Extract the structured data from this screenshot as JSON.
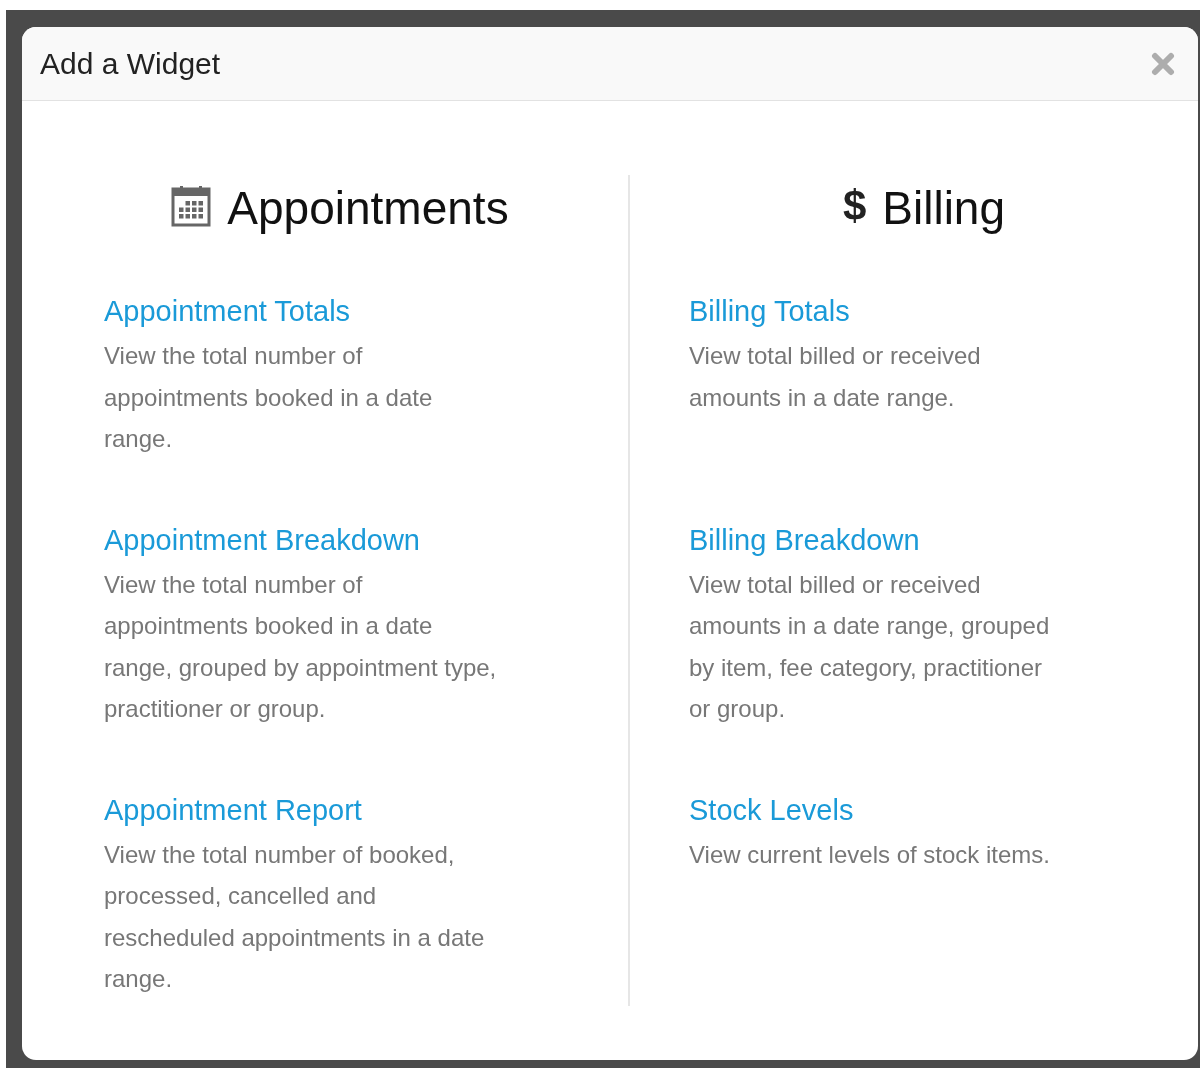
{
  "dialog": {
    "title": "Add a Widget"
  },
  "columns": [
    {
      "heading": "Appointments",
      "kind": "calendar",
      "items": [
        {
          "title": "Appointment Totals",
          "description": "View the total number of appointments booked in a date range."
        },
        {
          "title": "Appointment Breakdown",
          "description": "View the total number of appointments booked in a date range, grouped by appointment type, practitioner or group."
        },
        {
          "title": "Appointment Report",
          "description": "View the total number of booked, processed, cancelled and rescheduled appointments in a date range."
        }
      ]
    },
    {
      "heading": "Billing",
      "kind": "text",
      "icon_text": "$",
      "items": [
        {
          "title": "Billing Totals",
          "description": "View total billed or received amounts in a date range."
        },
        {
          "title": "Billing Breakdown",
          "description": "View total billed or received amounts in a date range, grouped by item, fee category, practitioner or group."
        },
        {
          "title": "Stock Levels",
          "description": "View current levels of stock items."
        }
      ]
    }
  ]
}
